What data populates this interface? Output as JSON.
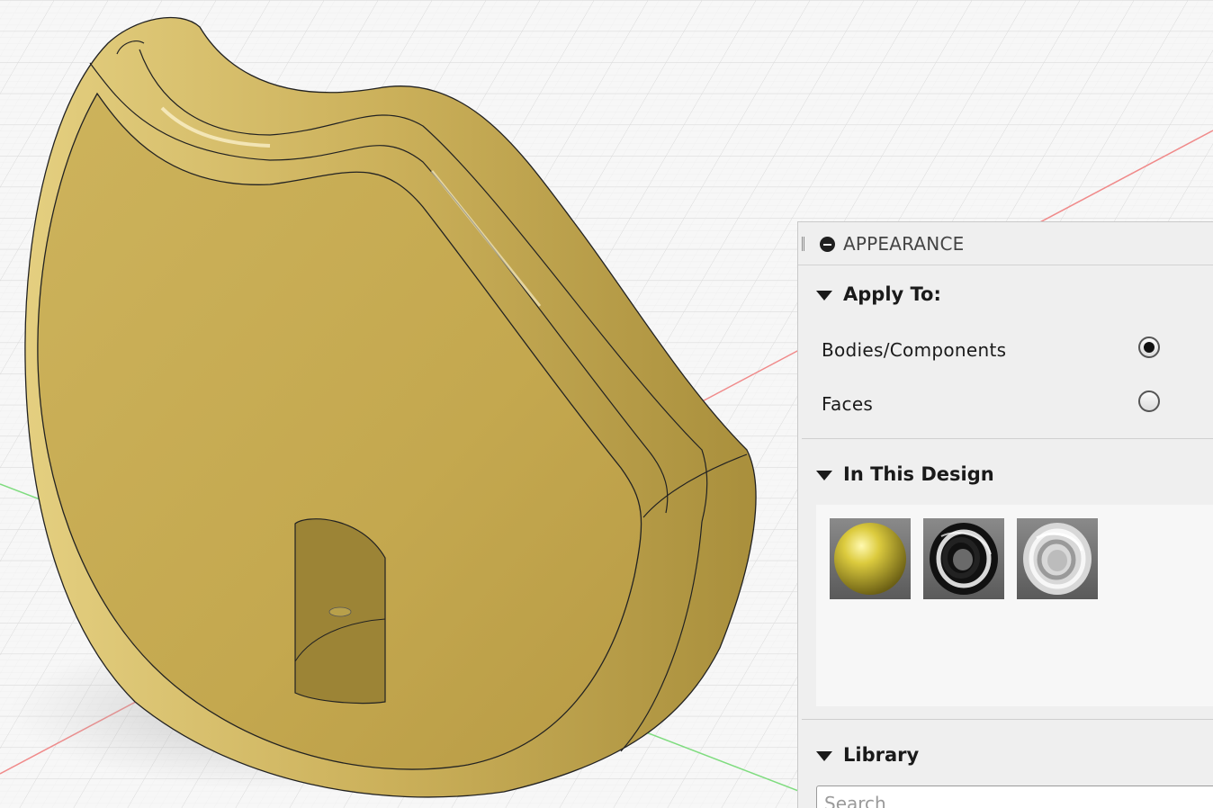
{
  "panel": {
    "title": "APPEARANCE",
    "apply_to": {
      "title": "Apply To:",
      "options": [
        {
          "label": "Bodies/Components",
          "checked": true
        },
        {
          "label": "Faces",
          "checked": false
        }
      ]
    },
    "in_this_design": {
      "title": "In This Design",
      "swatches": [
        {
          "material": "yellow-plastic",
          "color": "#d8c63a"
        },
        {
          "material": "black-chrome",
          "color": "#1a1a1a"
        },
        {
          "material": "chrome",
          "color": "#cfcfcf"
        }
      ]
    },
    "library": {
      "title": "Library",
      "search_placeholder": "Search"
    }
  },
  "model": {
    "body_color": "#c9ad55"
  }
}
